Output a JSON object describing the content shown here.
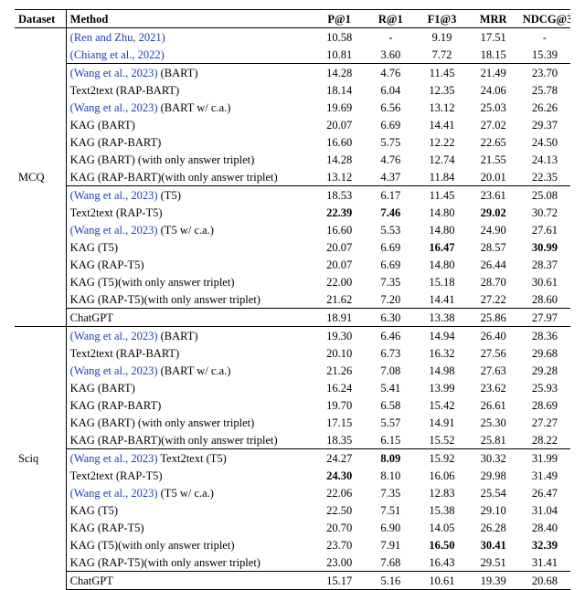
{
  "header": {
    "cols": [
      "Dataset",
      "Method",
      "P@1",
      "R@1",
      "F1@3",
      "MRR",
      "NDCG@3"
    ]
  },
  "chart_data": {
    "type": "table",
    "title": "",
    "datasets": [
      {
        "name": "MCQ",
        "groups": [
          [
            {
              "method_plain": "",
              "cite": "(Ren and Zhu, 2021)",
              "suffix": "",
              "p1": "10.58",
              "r1": "-",
              "f1": "9.19",
              "mrr": "17.51",
              "ndcg": "-"
            },
            {
              "method_plain": "",
              "cite": "(Chiang et al., 2022)",
              "suffix": "",
              "p1": "10.81",
              "r1": "3.60",
              "f1": "7.72",
              "mrr": "18.15",
              "ndcg": "15.39"
            }
          ],
          [
            {
              "method_plain": "",
              "cite": "(Wang et al., 2023)",
              "suffix": " (BART)",
              "p1": "14.28",
              "r1": "4.76",
              "f1": "11.45",
              "mrr": "21.49",
              "ndcg": "23.70"
            },
            {
              "method_plain": "Text2text (RAP-BART)",
              "cite": "",
              "suffix": "",
              "p1": "18.14",
              "r1": "6.04",
              "f1": "12.35",
              "mrr": "24.06",
              "ndcg": "25.78"
            },
            {
              "method_plain": "",
              "cite": "(Wang et al., 2023)",
              "suffix": " (BART w/ c.a.)",
              "p1": "19.69",
              "r1": "6.56",
              "f1": "13.12",
              "mrr": "25.03",
              "ndcg": "26.26"
            },
            {
              "method_plain": "KAG (BART)",
              "cite": "",
              "suffix": "",
              "p1": "20.07",
              "r1": "6.69",
              "f1": "14.41",
              "mrr": "27.02",
              "ndcg": "29.37"
            },
            {
              "method_plain": "KAG (RAP-BART)",
              "cite": "",
              "suffix": "",
              "p1": "16.60",
              "r1": "5.75",
              "f1": "12.22",
              "mrr": "22.65",
              "ndcg": "24.50"
            },
            {
              "method_plain": "KAG (BART) (with only answer triplet)",
              "cite": "",
              "suffix": "",
              "p1": "14.28",
              "r1": "4.76",
              "f1": "12.74",
              "mrr": "21.55",
              "ndcg": "24.13"
            },
            {
              "method_plain": "KAG (RAP-BART)(with only answer triplet)",
              "cite": "",
              "suffix": "",
              "p1": "13.12",
              "r1": "4.37",
              "f1": "11.84",
              "mrr": "20.01",
              "ndcg": "22.35"
            }
          ],
          [
            {
              "method_plain": "",
              "cite": "(Wang et al., 2023)",
              "suffix": " (T5)",
              "p1": "18.53",
              "r1": "6.17",
              "f1": "11.45",
              "mrr": "23.61",
              "ndcg": "25.08"
            },
            {
              "method_plain": "Text2text (RAP-T5)",
              "cite": "",
              "suffix": "",
              "p1": "22.39",
              "r1": "7.46",
              "f1": "14.80",
              "mrr": "29.02",
              "ndcg": "30.72",
              "bold": [
                "p1",
                "r1",
                "mrr"
              ]
            },
            {
              "method_plain": "",
              "cite": "(Wang et al., 2023)",
              "suffix": " (T5 w/ c.a.)",
              "p1": "16.60",
              "r1": "5.53",
              "f1": "14.80",
              "mrr": "24.90",
              "ndcg": "27.61"
            },
            {
              "method_plain": "KAG (T5)",
              "cite": "",
              "suffix": "",
              "p1": "20.07",
              "r1": "6.69",
              "f1": "16.47",
              "mrr": "28.57",
              "ndcg": "30.99",
              "bold": [
                "f1",
                "ndcg"
              ]
            },
            {
              "method_plain": "KAG (RAP-T5)",
              "cite": "",
              "suffix": "",
              "p1": "20.07",
              "r1": "6.69",
              "f1": "14.80",
              "mrr": "26.44",
              "ndcg": "28.37"
            },
            {
              "method_plain": "KAG (T5)(with only answer triplet)",
              "cite": "",
              "suffix": "",
              "p1": "22.00",
              "r1": "7.35",
              "f1": "15.18",
              "mrr": "28.70",
              "ndcg": "30.61"
            },
            {
              "method_plain": "KAG (RAP-T5)(with only answer triplet)",
              "cite": "",
              "suffix": "",
              "p1": "21.62",
              "r1": "7.20",
              "f1": "14.41",
              "mrr": "27.22",
              "ndcg": "28.60"
            }
          ],
          [
            {
              "method_plain": "ChatGPT",
              "cite": "",
              "suffix": "",
              "p1": "18.91",
              "r1": "6.30",
              "f1": "13.38",
              "mrr": "25.86",
              "ndcg": "27.97"
            }
          ]
        ]
      },
      {
        "name": "Sciq",
        "groups": [
          [
            {
              "method_plain": "",
              "cite": "(Wang et al., 2023)",
              "suffix": " (BART)",
              "p1": "19.30",
              "r1": "6.46",
              "f1": "14.94",
              "mrr": "26.40",
              "ndcg": "28.36"
            },
            {
              "method_plain": "Text2text (RAP-BART)",
              "cite": "",
              "suffix": "",
              "p1": "20.10",
              "r1": "6.73",
              "f1": "16.32",
              "mrr": "27.56",
              "ndcg": "29.68"
            },
            {
              "method_plain": "",
              "cite": "(Wang et al., 2023)",
              "suffix": " (BART w/ c.a.)",
              "p1": "21.26",
              "r1": "7.08",
              "f1": "14.98",
              "mrr": "27.63",
              "ndcg": "29.28"
            },
            {
              "method_plain": "KAG (BART)",
              "cite": "",
              "suffix": "",
              "p1": "16.24",
              "r1": "5.41",
              "f1": "13.99",
              "mrr": "23.62",
              "ndcg": "25.93"
            },
            {
              "method_plain": "KAG (RAP-BART)",
              "cite": "",
              "suffix": "",
              "p1": "19.70",
              "r1": "6.58",
              "f1": "15.42",
              "mrr": "26.61",
              "ndcg": "28.69"
            },
            {
              "method_plain": "KAG (BART) (with only answer triplet)",
              "cite": "",
              "suffix": "",
              "p1": "17.15",
              "r1": "5.57",
              "f1": "14.91",
              "mrr": "25.30",
              "ndcg": "27.27"
            },
            {
              "method_plain": "KAG (RAP-BART)(with only answer triplet)",
              "cite": "",
              "suffix": "",
              "p1": "18.35",
              "r1": "6.15",
              "f1": "15.52",
              "mrr": "25.81",
              "ndcg": "28.22"
            }
          ],
          [
            {
              "method_plain": "",
              "cite": "(Wang et al., 2023)",
              "suffix": " Text2text (T5)",
              "p1": "24.27",
              "r1": "8.09",
              "f1": "15.92",
              "mrr": "30.32",
              "ndcg": "31.99",
              "bold": [
                "r1"
              ]
            },
            {
              "method_plain": "Text2text (RAP-T5)",
              "cite": "",
              "suffix": "",
              "p1": "24.30",
              "r1": "8.10",
              "f1": "16.06",
              "mrr": "29.98",
              "ndcg": "31.49",
              "bold": [
                "p1"
              ]
            },
            {
              "method_plain": "",
              "cite": "(Wang et al., 2023)",
              "suffix": " (T5 w/ c.a.)",
              "p1": "22.06",
              "r1": "7.35",
              "f1": "12.83",
              "mrr": "25.54",
              "ndcg": "26.47"
            },
            {
              "method_plain": "KAG (T5)",
              "cite": "",
              "suffix": "",
              "p1": "22.50",
              "r1": "7.51",
              "f1": "15.38",
              "mrr": "29.10",
              "ndcg": "31.04"
            },
            {
              "method_plain": "KAG (RAP-T5)",
              "cite": "",
              "suffix": "",
              "p1": "20.70",
              "r1": "6.90",
              "f1": "14.05",
              "mrr": "26.28",
              "ndcg": "28.40"
            },
            {
              "method_plain": "KAG (T5)(with only answer triplet)",
              "cite": "",
              "suffix": "",
              "p1": "23.70",
              "r1": "7.91",
              "f1": "16.50",
              "mrr": "30.41",
              "ndcg": "32.39",
              "bold": [
                "f1",
                "mrr",
                "ndcg"
              ]
            },
            {
              "method_plain": "KAG (RAP-T5)(with only answer triplet)",
              "cite": "",
              "suffix": "",
              "p1": "23.00",
              "r1": "7.68",
              "f1": "16.43",
              "mrr": "29.51",
              "ndcg": "31.41"
            }
          ],
          [
            {
              "method_plain": "ChatGPT",
              "cite": "",
              "suffix": "",
              "p1": "15.17",
              "r1": "5.16",
              "f1": "10.61",
              "mrr": "19.39",
              "ndcg": "20.68"
            }
          ]
        ]
      }
    ]
  }
}
